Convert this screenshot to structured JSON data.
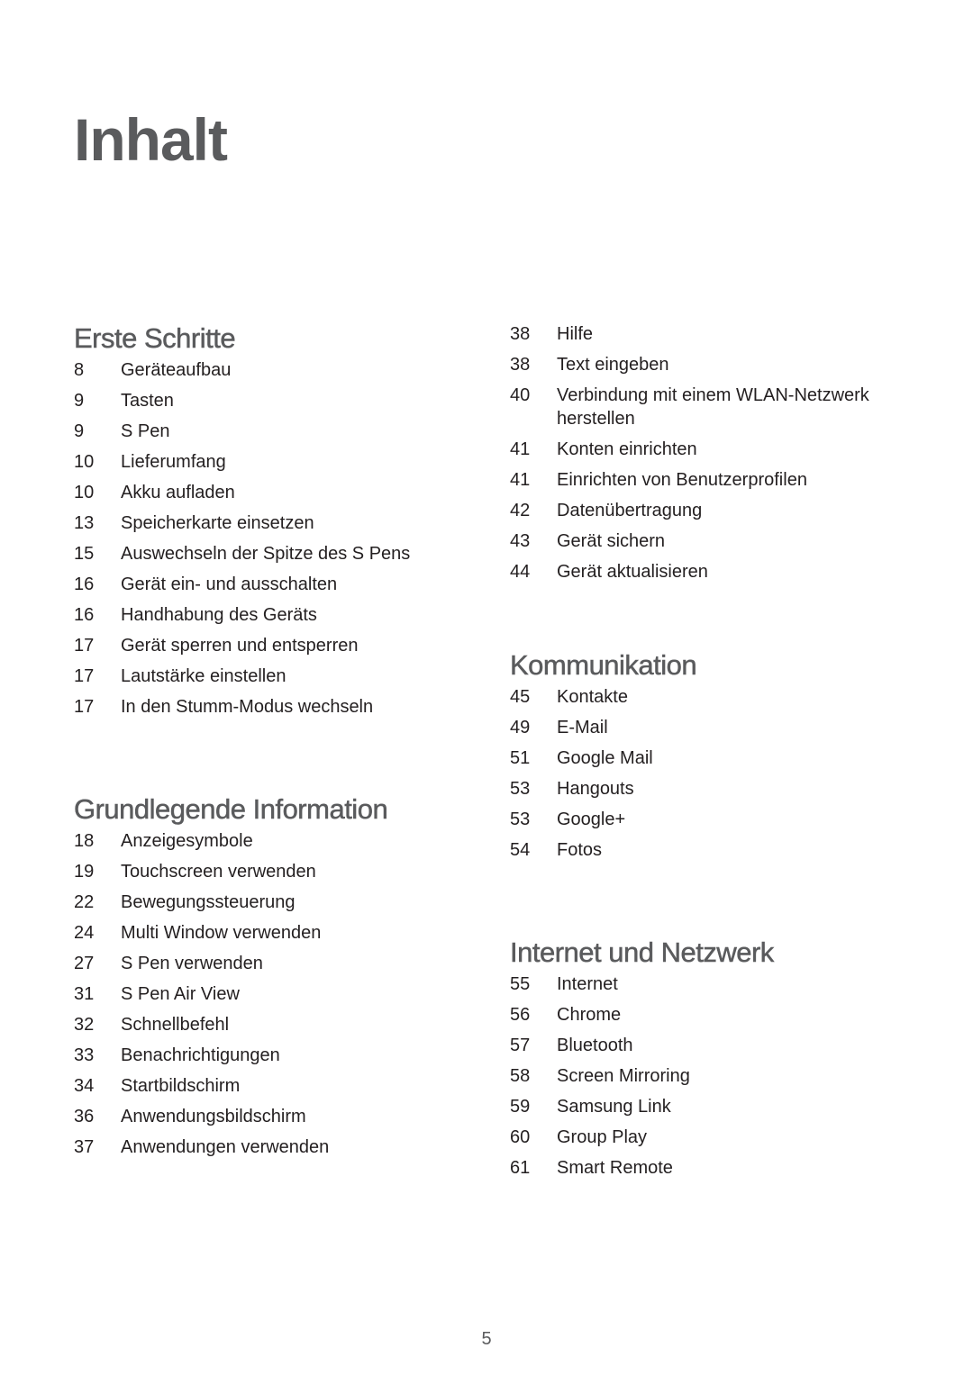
{
  "title": "Inhalt",
  "page_number": "5",
  "sections": {
    "erste_schritte": {
      "title": "Erste Schritte",
      "items": [
        {
          "page": "8",
          "label": "Geräteaufbau"
        },
        {
          "page": "9",
          "label": "Tasten"
        },
        {
          "page": "9",
          "label": "S Pen"
        },
        {
          "page": "10",
          "label": "Lieferumfang"
        },
        {
          "page": "10",
          "label": "Akku aufladen"
        },
        {
          "page": "13",
          "label": "Speicherkarte einsetzen"
        },
        {
          "page": "15",
          "label": "Auswechseln der Spitze des S Pens"
        },
        {
          "page": "16",
          "label": "Gerät ein- und ausschalten"
        },
        {
          "page": "16",
          "label": "Handhabung des Geräts"
        },
        {
          "page": "17",
          "label": "Gerät sperren und entsperren"
        },
        {
          "page": "17",
          "label": "Lautstärke einstellen"
        },
        {
          "page": "17",
          "label": "In den Stumm-Modus wechseln"
        }
      ]
    },
    "grundlegende_information": {
      "title": "Grundlegende Information",
      "items": [
        {
          "page": "18",
          "label": "Anzeigesymbole"
        },
        {
          "page": "19",
          "label": "Touchscreen verwenden"
        },
        {
          "page": "22",
          "label": "Bewegungssteuerung"
        },
        {
          "page": "24",
          "label": "Multi Window verwenden"
        },
        {
          "page": "27",
          "label": "S Pen verwenden"
        },
        {
          "page": "31",
          "label": "S Pen Air View"
        },
        {
          "page": "32",
          "label": "Schnellbefehl"
        },
        {
          "page": "33",
          "label": "Benachrichtigungen"
        },
        {
          "page": "34",
          "label": "Startbildschirm"
        },
        {
          "page": "36",
          "label": "Anwendungsbildschirm"
        },
        {
          "page": "37",
          "label": "Anwendungen verwenden"
        },
        {
          "page": "38",
          "label": "Hilfe"
        },
        {
          "page": "38",
          "label": "Text eingeben"
        },
        {
          "page": "40",
          "label": "Verbindung mit einem WLAN-Netzwerk herstellen"
        },
        {
          "page": "41",
          "label": "Konten einrichten"
        },
        {
          "page": "41",
          "label": "Einrichten von Benutzerprofilen"
        },
        {
          "page": "42",
          "label": "Datenübertragung"
        },
        {
          "page": "43",
          "label": "Gerät sichern"
        },
        {
          "page": "44",
          "label": "Gerät aktualisieren"
        }
      ]
    },
    "kommunikation": {
      "title": "Kommunikation",
      "items": [
        {
          "page": "45",
          "label": "Kontakte"
        },
        {
          "page": "49",
          "label": "E-Mail"
        },
        {
          "page": "51",
          "label": "Google Mail"
        },
        {
          "page": "53",
          "label": "Hangouts"
        },
        {
          "page": "53",
          "label": "Google+"
        },
        {
          "page": "54",
          "label": "Fotos"
        }
      ]
    },
    "internet_und_netzwerk": {
      "title": "Internet und Netzwerk",
      "items": [
        {
          "page": "55",
          "label": "Internet"
        },
        {
          "page": "56",
          "label": "Chrome"
        },
        {
          "page": "57",
          "label": "Bluetooth"
        },
        {
          "page": "58",
          "label": "Screen Mirroring"
        },
        {
          "page": "59",
          "label": "Samsung Link"
        },
        {
          "page": "60",
          "label": "Group Play"
        },
        {
          "page": "61",
          "label": "Smart Remote"
        }
      ]
    }
  }
}
